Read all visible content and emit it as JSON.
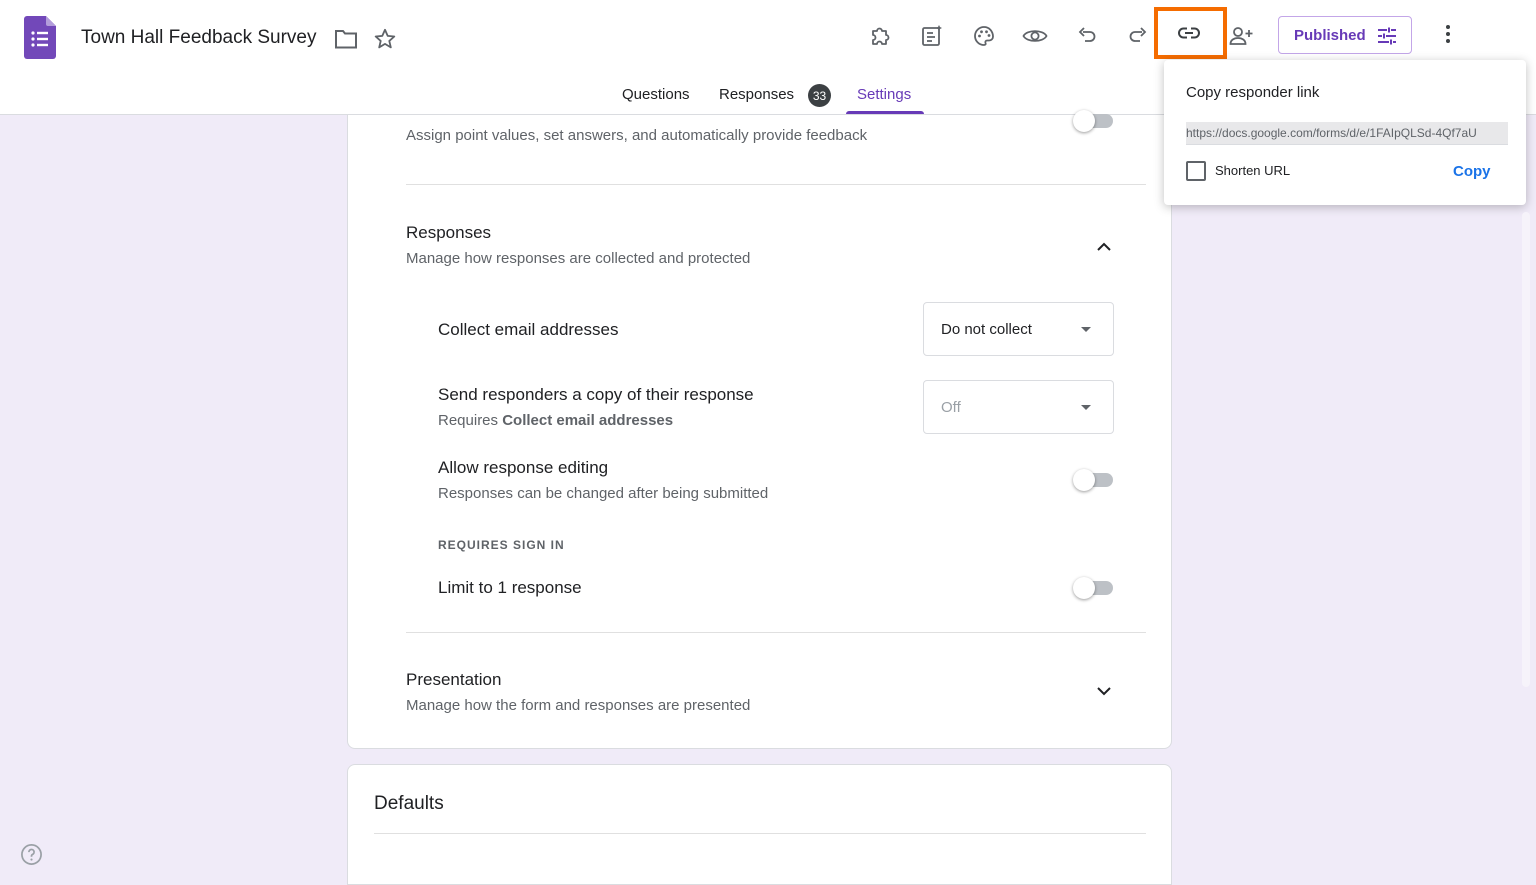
{
  "header": {
    "doc_title": "Town Hall Feedback Survey",
    "published_label": "Published"
  },
  "tabs": [
    {
      "label": "Questions"
    },
    {
      "label": "Responses",
      "badge": "33"
    },
    {
      "label": "Settings",
      "active": true
    }
  ],
  "quiz": {
    "subtitle": "Assign point values, set answers, and automatically provide feedback"
  },
  "responses_section": {
    "title": "Responses",
    "subtitle": "Manage how responses are collected and protected",
    "collect_email": {
      "label": "Collect email addresses",
      "value": "Do not collect"
    },
    "send_copy": {
      "label": "Send responders a copy of their response",
      "sub_prefix": "Requires ",
      "sub_bold": "Collect email addresses",
      "value": "Off"
    },
    "allow_editing": {
      "label": "Allow response editing",
      "sub": "Responses can be changed after being submitted"
    },
    "requires_sign_in": "REQUIRES SIGN IN",
    "limit_one": {
      "label": "Limit to 1 response"
    }
  },
  "presentation_section": {
    "title": "Presentation",
    "subtitle": "Manage how the form and responses are presented"
  },
  "defaults_section": {
    "title": "Defaults"
  },
  "popup": {
    "title": "Copy responder link",
    "url": "https://docs.google.com/forms/d/e/1FAIpQLSd-4Qf7aU",
    "shorten_label": "Shorten URL",
    "copy_label": "Copy"
  },
  "colors": {
    "accent": "#673ab7",
    "highlight": "#f56c00",
    "link_blue": "#1a73e8",
    "background": "#f0ebf8"
  }
}
